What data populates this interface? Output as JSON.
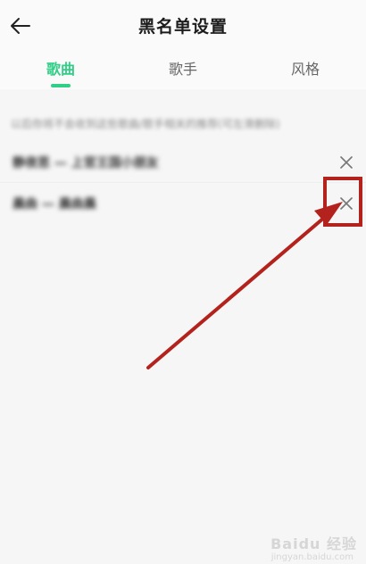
{
  "header": {
    "title": "黑名单设置",
    "back_icon": "arrow-left-icon"
  },
  "tabs": [
    {
      "label": "歌曲",
      "active": true
    },
    {
      "label": "歌手",
      "active": false
    },
    {
      "label": "风格",
      "active": false
    }
  ],
  "content": {
    "hint": "以后你将不会收到这些歌曲/歌手相关的推荐(可左滑删除)",
    "items": [
      {
        "title": "静夜思 — 上官王国小朋友"
      },
      {
        "title": "晨曲 — 晨曲晨"
      }
    ]
  },
  "annotation": {
    "arrow_color": "#b3221c"
  },
  "watermark": {
    "text": "Baidu 经验",
    "sub": "jingyan.baidu.com"
  },
  "colors": {
    "accent": "#2fcf86",
    "annotation": "#b3221c"
  }
}
